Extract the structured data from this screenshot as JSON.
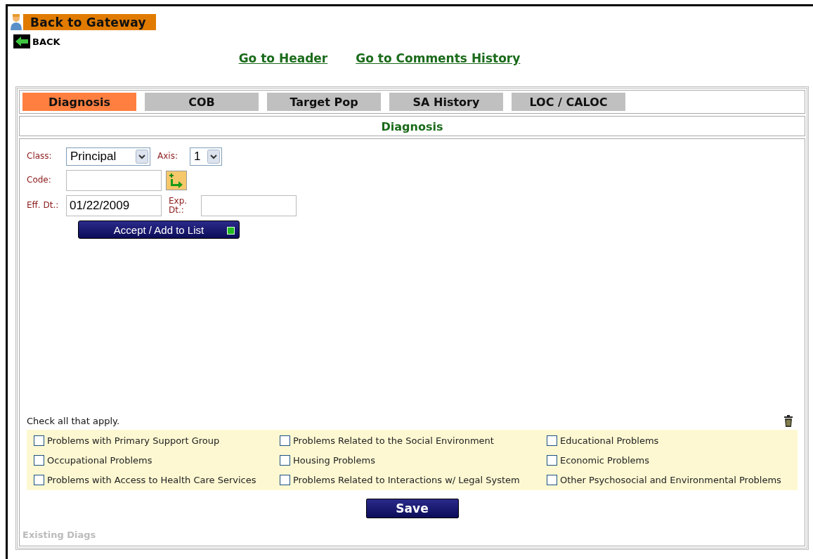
{
  "gateway": {
    "label": "Back to Gateway"
  },
  "back": {
    "label": "BACK"
  },
  "links": [
    "Go to Header",
    "Go to Comments History"
  ],
  "tabs": [
    {
      "label": "Diagnosis",
      "selected": true
    },
    {
      "label": "COB",
      "selected": false
    },
    {
      "label": "Target Pop",
      "selected": false
    },
    {
      "label": "SA History",
      "selected": false
    },
    {
      "label": "LOC / CALOC",
      "selected": false
    }
  ],
  "section_title": "Diagnosis",
  "form": {
    "class_label": "Class:",
    "class_value": "Principal",
    "axis_label": "Axis:",
    "axis_value": "1",
    "code_label": "Code:",
    "eff_label": "Eff. Dt.:",
    "eff_value": "01/22/2009",
    "exp_label": "Exp. Dt.:",
    "accept_button": "Accept / Add to List"
  },
  "check_hint": "Check all that apply.",
  "problems": [
    {
      "label": "Problems with Primary Support Group",
      "checked": false
    },
    {
      "label": "Problems Related to the Social Environment",
      "checked": false
    },
    {
      "label": "Educational Problems",
      "checked": false
    },
    {
      "label": "Occupational Problems",
      "checked": false
    },
    {
      "label": "Housing Problems",
      "checked": false
    },
    {
      "label": "Economic Problems",
      "checked": false
    },
    {
      "label": "Problems with Access to Health Care Services",
      "checked": false
    },
    {
      "label": "Problems Related to Interactions w/ Legal System",
      "checked": false
    },
    {
      "label": "Other Psychosocial and Environmental Problems",
      "checked": false
    }
  ],
  "save_button": "Save",
  "existing_label": "Existing Diags"
}
